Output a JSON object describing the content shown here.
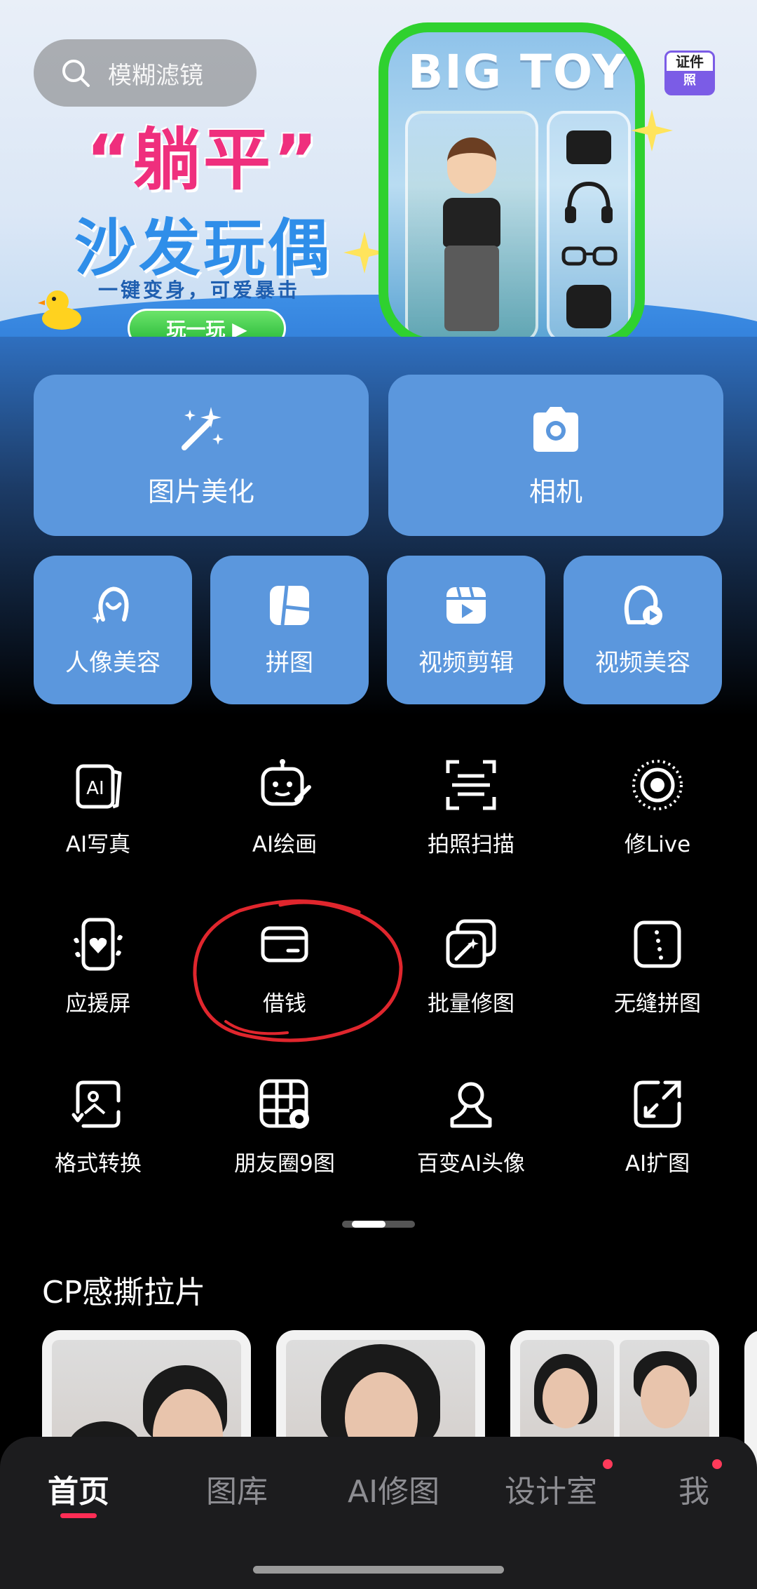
{
  "banner": {
    "search_placeholder": "模糊滤镜",
    "title_line1": "“躺平”",
    "title_line2": "沙发玩偶",
    "subtitle": "一键变身，可爱暴击",
    "play_button": "玩一玩 ▶",
    "toy_title": "BIG TOY",
    "id_photo_top": "证件",
    "id_photo_bottom": "照"
  },
  "main_tools": [
    {
      "label": "图片美化",
      "icon": "magic-wand-icon"
    },
    {
      "label": "相机",
      "icon": "camera-icon"
    }
  ],
  "secondary_tools": [
    {
      "label": "人像美容",
      "icon": "face-sparkle-icon"
    },
    {
      "label": "拼图",
      "icon": "collage-icon"
    },
    {
      "label": "视频剪辑",
      "icon": "video-edit-icon"
    },
    {
      "label": "视频美容",
      "icon": "video-beauty-icon"
    }
  ],
  "feature_grid": [
    {
      "label": "AI写真",
      "icon": "ai-photo-icon"
    },
    {
      "label": "AI绘画",
      "icon": "ai-paint-icon"
    },
    {
      "label": "拍照扫描",
      "icon": "scan-icon"
    },
    {
      "label": "修Live",
      "icon": "live-photo-icon"
    },
    {
      "label": "应援屏",
      "icon": "cheer-screen-icon"
    },
    {
      "label": "借钱",
      "icon": "card-icon"
    },
    {
      "label": "批量修图",
      "icon": "batch-edit-icon"
    },
    {
      "label": "无缝拼图",
      "icon": "seamless-collage-icon"
    },
    {
      "label": "格式转换",
      "icon": "format-convert-icon"
    },
    {
      "label": "朋友圈9图",
      "icon": "nine-grid-icon"
    },
    {
      "label": "百变AI头像",
      "icon": "ai-avatar-icon"
    },
    {
      "label": "AI扩图",
      "icon": "ai-expand-icon"
    }
  ],
  "section": {
    "title": "CP感撕拉片"
  },
  "tabs": [
    {
      "label": "首页",
      "active": true
    },
    {
      "label": "图库",
      "active": false
    },
    {
      "label": "AI修图",
      "active": false
    },
    {
      "label": "设计室",
      "active": false,
      "badge": true
    },
    {
      "label": "我",
      "active": false,
      "badge": true
    }
  ],
  "colors": {
    "tile_blue": "#5b97dd",
    "accent_red": "#ff2d55",
    "tab_bar": "#1c1c1e"
  }
}
